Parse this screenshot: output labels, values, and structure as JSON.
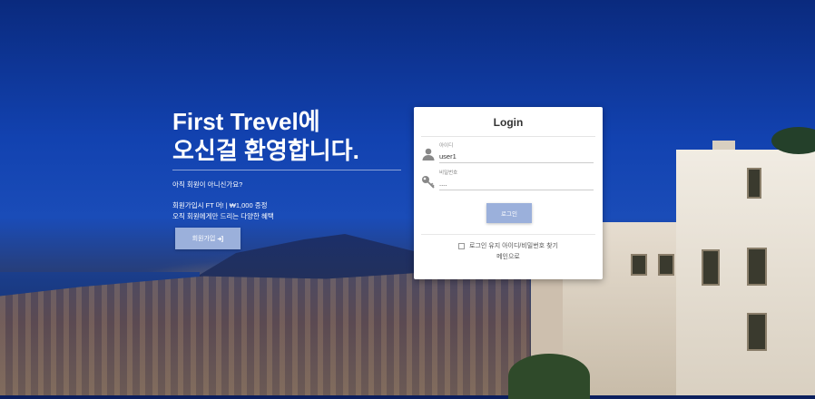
{
  "hero": {
    "title_line1": "First Trevel에",
    "title_line2": "오신걸 환영합니다.",
    "question": "아직 회원이 아니신가요?",
    "benefit_line1": "회원가입시 FT 머! | ₩1,000 증정",
    "benefit_line2": "오직 회원에게만 드리는 다양한 혜택",
    "signup_label": "회원가입",
    "signup_icon": "sign-in-icon"
  },
  "login": {
    "title": "Login",
    "id_label": "아이디",
    "id_value": "user1",
    "id_icon": "user-icon",
    "pw_label": "비밀번호",
    "pw_value": "....",
    "pw_icon": "key-icon",
    "submit_label": "로그인",
    "remember_label": "로그인 유지",
    "find_label": "아이디/비밀번호 찾기",
    "main_link": "메인으로"
  },
  "colors": {
    "button": "#9bb0db",
    "accent_sky": "#1242b0"
  }
}
